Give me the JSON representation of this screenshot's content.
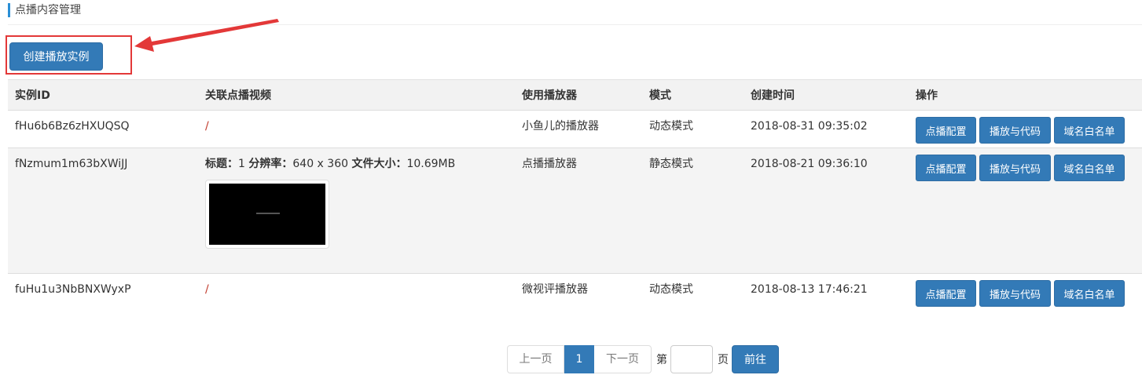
{
  "page": {
    "title": "点播内容管理"
  },
  "create_button": {
    "label": "创建播放实例"
  },
  "table": {
    "headers": {
      "id": "实例ID",
      "video": "关联点播视频",
      "player": "使用播放器",
      "mode": "模式",
      "created": "创建时间",
      "ops": "操作"
    },
    "rows": [
      {
        "id": "fHu6b6Bz6zHXUQSQ",
        "video": "/",
        "player": "小鱼儿的播放器",
        "mode": "动态模式",
        "created": "2018-08-31 09:35:02"
      },
      {
        "id": "fNzmum1m63bXWiJJ",
        "video_meta": {
          "title_label": "标题：",
          "title_value": "1",
          "res_label": "分辨率：",
          "res_value": "640 x 360",
          "size_label": "文件大小：",
          "size_value": "10.69MB"
        },
        "player": "点播播放器",
        "mode": "静态模式",
        "created": "2018-08-21 09:36:10"
      },
      {
        "id": "fuHu1u3NbBNXWyxP",
        "video": "/",
        "player": "微视评播放器",
        "mode": "动态模式",
        "created": "2018-08-13 17:46:21"
      }
    ],
    "op_buttons": {
      "config": "点播配置",
      "play_code": "播放与代码",
      "whitelist": "域名白名单"
    }
  },
  "pagination": {
    "prev": "上一页",
    "current": "1",
    "next": "下一页",
    "goto_prefix": "第",
    "goto_suffix": "页",
    "goto_value": "",
    "go_button": "前往"
  },
  "colors": {
    "primary": "#337ab7",
    "annotation_red": "#e33838",
    "title_accent": "#2a8fd6"
  }
}
